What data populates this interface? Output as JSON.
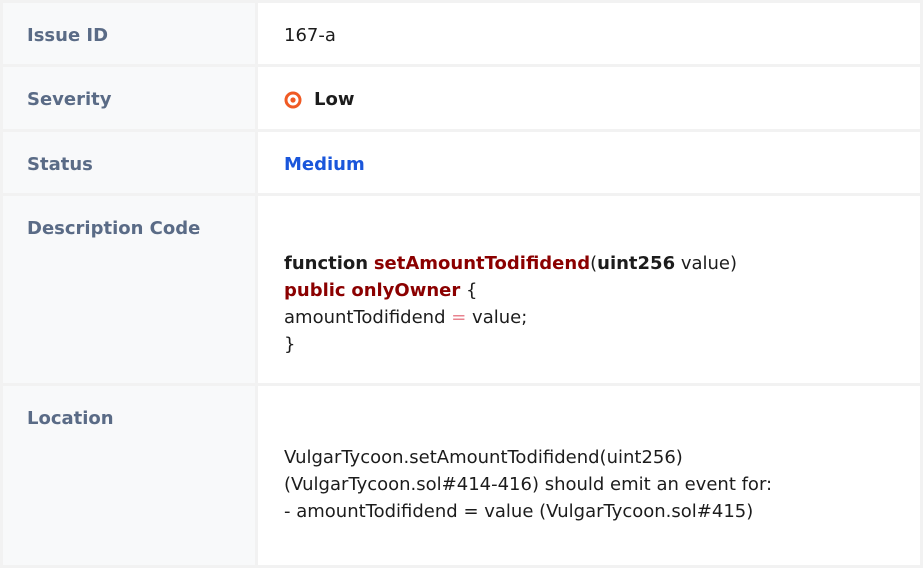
{
  "rows": {
    "issue_id": {
      "label": "Issue ID",
      "value": "167-a"
    },
    "severity": {
      "label": "Severity",
      "value": "Low",
      "icon": "target-circle-icon",
      "icon_color": "#f05a24"
    },
    "status": {
      "label": "Status",
      "value": "Medium",
      "value_color": "#1a56db"
    },
    "description": {
      "label": "Description Code",
      "code": {
        "kw_function": "function",
        "fn_name": "setAmountTodifidend",
        "paren_open": "(",
        "param_type": "uint256",
        "param_rest": " value)",
        "kw_public": "public",
        "kw_only_owner": "onlyOwner",
        "brace_open": " {",
        "assign_lhs": "amountTodifidend ",
        "assign_op": "=",
        "assign_rhs": " value;",
        "brace_close": "}"
      }
    },
    "location": {
      "label": "Location",
      "lines": [
        "VulgarTycoon.setAmountTodifidend(uint256)",
        "(VulgarTycoon.sol#414-416) should emit an event for:",
        "- amountTodifidend = value (VulgarTycoon.sol#415)"
      ]
    }
  }
}
